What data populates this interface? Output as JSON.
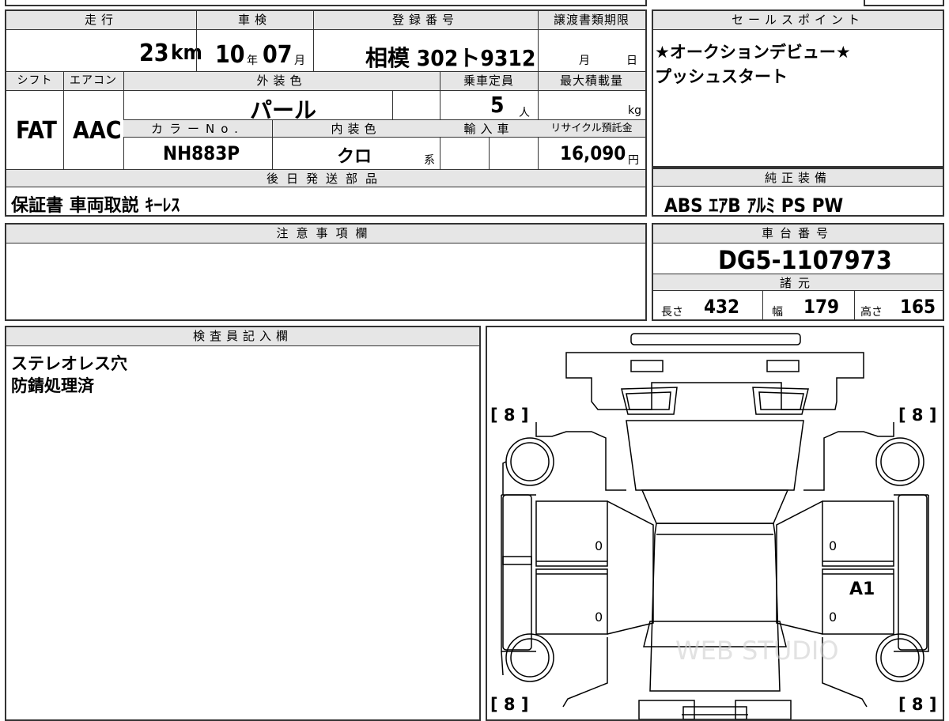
{
  "top_info": {
    "headers": {
      "mileage": "走行",
      "inspection": "車検",
      "registration": "登録番号",
      "transfer_deadline": "譲渡書類期限"
    },
    "mileage_value": "23",
    "mileage_unit": "km",
    "inspection_year": "10",
    "inspection_year_unit": "年",
    "inspection_month": "07",
    "inspection_month_unit": "月",
    "registration_value": "相模 302ト9312",
    "deadline_month_unit": "月",
    "deadline_day_unit": "日"
  },
  "spec": {
    "headers": {
      "shift": "シフト",
      "aircon": "エアコン",
      "exterior_color": "外装色",
      "capacity": "乗車定員",
      "max_load": "最大積載量",
      "color_no": "カラーNo.",
      "interior_color": "内装色",
      "import": "輸入車",
      "recycle_fee": "リサイクル預託金"
    },
    "shift_value": "FAT",
    "aircon_value": "AAC",
    "exterior_color_value": "パール",
    "capacity_value": "5",
    "capacity_unit": "人",
    "max_load_unit": "kg",
    "color_no_value": "NH883P",
    "interior_color_value": "クロ",
    "interior_color_suffix": "系",
    "recycle_fee_value": "16,090",
    "recycle_fee_unit": "円"
  },
  "later_parts": {
    "header": "後日発送部品",
    "value": "保証書 車両取説 ｷｰﾚｽ"
  },
  "sales_points": {
    "header": "セールスポイント",
    "line1": "★オークションデビュー★",
    "line2": "プッシュスタート"
  },
  "genuine_equipment": {
    "header": "純正装備",
    "value": "ABS ｴｱB ｱﾙﾐ PS PW"
  },
  "notes": {
    "header": "注意事項欄",
    "value": ""
  },
  "chassis": {
    "header": "車台番号",
    "value": "DG5-1107973"
  },
  "dimensions": {
    "header": "諸元",
    "length_label": "長さ",
    "length_value": "432",
    "width_label": "幅",
    "width_value": "179",
    "height_label": "高さ",
    "height_value": "165"
  },
  "inspector": {
    "header": "検査員記入欄",
    "line1": "ステレオレス穴",
    "line2": "防錆処理済"
  },
  "diagram": {
    "tire_front_left": "[ 8 ]",
    "tire_front_right": "[ 8 ]",
    "tire_rear_left": "[ 8 ]",
    "tire_rear_right": "[ 8 ]",
    "panel_left_front": "0",
    "panel_left_rear": "0",
    "panel_right_front": "0",
    "panel_right_rear": "0",
    "damage_code": "A1",
    "watermark": "WEB STUDIO"
  }
}
